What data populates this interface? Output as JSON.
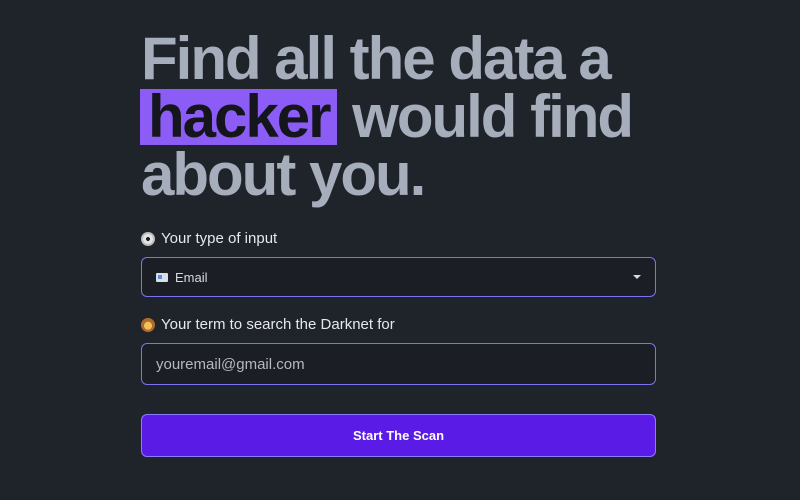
{
  "headline": {
    "line1": "Find all the data a",
    "highlight": "hacker",
    "line2_rest": " would find",
    "line3": "about you."
  },
  "input_type": {
    "label": "Your type of input",
    "label_icon": "disc-icon",
    "selected_value": "Email",
    "selected_icon": "id-card-icon"
  },
  "search_term": {
    "label": "Your term to search the Darknet for",
    "label_icon": "detective-face-icon",
    "placeholder": "youremail@gmail.com",
    "value": ""
  },
  "actions": {
    "start_scan_label": "Start The Scan"
  },
  "colors": {
    "background": "#1f232a",
    "headline_text": "#a6adbb",
    "highlight": "#8b5cf6",
    "field_border": "#7b74f0",
    "button": "#5b1be6"
  }
}
